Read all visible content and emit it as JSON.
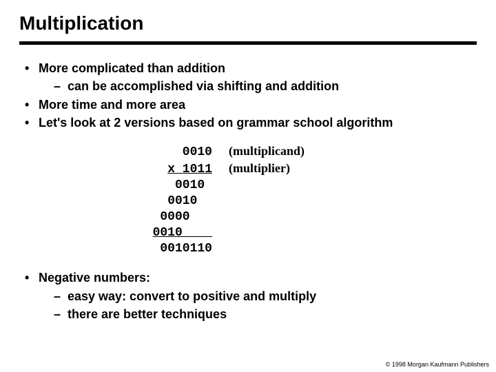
{
  "title": "Multiplication",
  "bullets": {
    "b1": "More complicated than addition",
    "b1a": "can be accomplished via shifting and addition",
    "b2": "More time and more area",
    "b3": "Let's look at 2 versions based on grammar school algorithm"
  },
  "calc": {
    "r1": "0010",
    "r1_label": "(multiplicand)",
    "r2": "x 1011",
    "r2_label": "(multiplier)",
    "r3": "0010 ",
    "r4": "0010  ",
    "r5": "0000   ",
    "r6": "0010    ",
    "r7": "0010110"
  },
  "neg": {
    "heading": "Negative numbers:",
    "n1": "easy way: convert to positive and multiply",
    "n2": "there are better techniques"
  },
  "copyright": "© 1998 Morgan Kaufmann Publishers"
}
